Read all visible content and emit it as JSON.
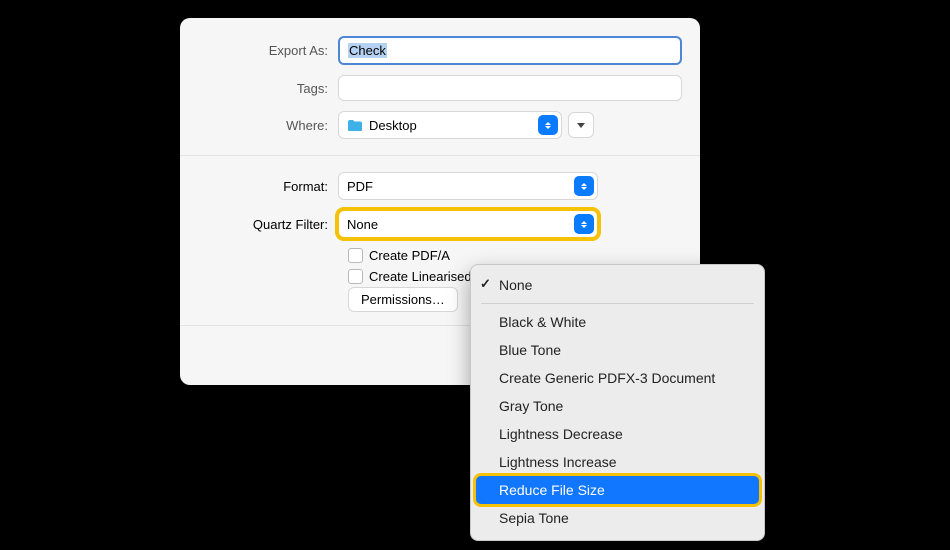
{
  "exportAs": {
    "label": "Export As:",
    "value": "Check"
  },
  "tags": {
    "label": "Tags:",
    "value": ""
  },
  "where": {
    "label": "Where:",
    "value": "Desktop"
  },
  "format": {
    "label": "Format:",
    "value": "PDF"
  },
  "quartzFilter": {
    "label": "Quartz Filter:",
    "value": "None"
  },
  "checkboxes": {
    "createPdfA": "Create PDF/A",
    "createLinearised": "Create Linearised PDF"
  },
  "permissions": {
    "label": "Permissions…"
  },
  "menu": {
    "checked": "None",
    "items": [
      "Black & White",
      "Blue Tone",
      "Create Generic PDFX-3 Document",
      "Gray Tone",
      "Lightness Decrease",
      "Lightness Increase",
      "Reduce File Size",
      "Sepia Tone"
    ],
    "highlighted": "Reduce File Size"
  }
}
